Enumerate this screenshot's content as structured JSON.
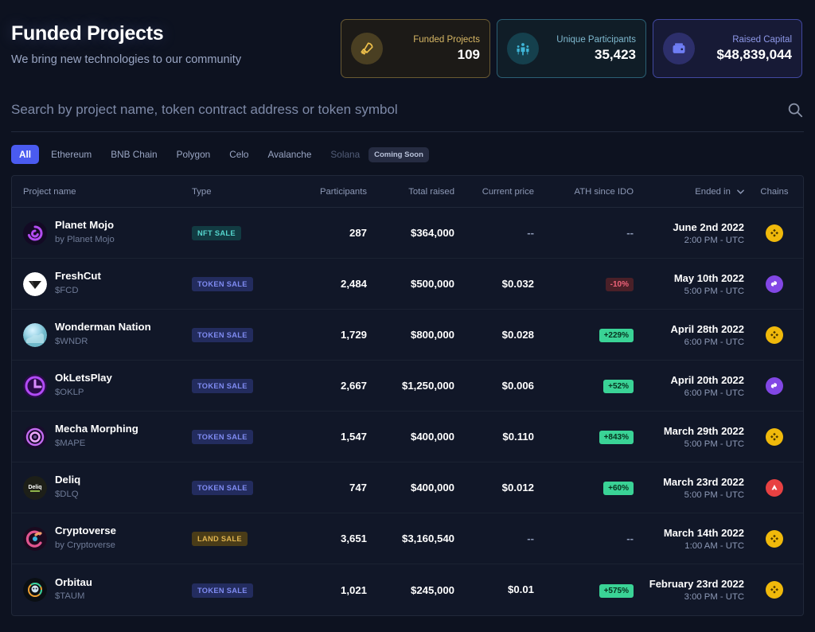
{
  "header": {
    "title": "Funded Projects",
    "subtitle": "We bring new technologies to our community",
    "stats": [
      {
        "label": "Funded Projects",
        "value": "109",
        "icon": "rocket-icon",
        "accent": "#d7b765"
      },
      {
        "label": "Unique Participants",
        "value": "35,423",
        "icon": "people-icon",
        "accent": "#7fb9cf"
      },
      {
        "label": "Raised Capital",
        "value": "$48,839,044",
        "icon": "wallet-icon",
        "accent": "#8e98e8"
      }
    ]
  },
  "search": {
    "placeholder": "Search by project name, token contract address or token symbol",
    "value": "",
    "icon": "search-icon"
  },
  "filters": {
    "tabs": [
      {
        "label": "All",
        "active": true,
        "disabled": false
      },
      {
        "label": "Ethereum",
        "active": false,
        "disabled": false
      },
      {
        "label": "BNB Chain",
        "active": false,
        "disabled": false
      },
      {
        "label": "Polygon",
        "active": false,
        "disabled": false
      },
      {
        "label": "Celo",
        "active": false,
        "disabled": false
      },
      {
        "label": "Avalanche",
        "active": false,
        "disabled": false
      },
      {
        "label": "Solana",
        "active": false,
        "disabled": true
      }
    ],
    "coming_soon_label": "Coming Soon"
  },
  "table": {
    "columns": [
      "Project name",
      "Type",
      "Participants",
      "Total raised",
      "Current price",
      "ATH since IDO",
      "Ended in",
      "Chains"
    ],
    "sort": {
      "column": "Ended in",
      "icon": "chevron-down-icon"
    },
    "rows": [
      {
        "name": "Planet Mojo",
        "sub": "by Planet Mojo",
        "logo": "planet-mojo-logo",
        "type": "NFT SALE",
        "type_kind": "nft",
        "participants": "287",
        "total_raised": "$364,000",
        "current_price": "--",
        "ath": "--",
        "ath_kind": "none",
        "date": "June 2nd 2022",
        "time": "2:00 PM - UTC",
        "chain": "BNB Chain",
        "chain_kind": "bnb"
      },
      {
        "name": "FreshCut",
        "sub": "$FCD",
        "logo": "freshcut-logo",
        "type": "TOKEN SALE",
        "type_kind": "token",
        "participants": "2,484",
        "total_raised": "$500,000",
        "current_price": "$0.032",
        "ath": "-10%",
        "ath_kind": "down",
        "date": "May 10th 2022",
        "time": "5:00 PM - UTC",
        "chain": "Polygon",
        "chain_kind": "polygon"
      },
      {
        "name": "Wonderman Nation",
        "sub": "$WNDR",
        "logo": "wonderman-nation-logo",
        "type": "TOKEN SALE",
        "type_kind": "token",
        "participants": "1,729",
        "total_raised": "$800,000",
        "current_price": "$0.028",
        "ath": "+229%",
        "ath_kind": "up",
        "date": "April 28th 2022",
        "time": "6:00 PM - UTC",
        "chain": "BNB Chain",
        "chain_kind": "bnb"
      },
      {
        "name": "OkLetsPlay",
        "sub": "$OKLP",
        "logo": "okletsplay-logo",
        "type": "TOKEN SALE",
        "type_kind": "token",
        "participants": "2,667",
        "total_raised": "$1,250,000",
        "current_price": "$0.006",
        "ath": "+52%",
        "ath_kind": "up",
        "date": "April 20th 2022",
        "time": "6:00 PM - UTC",
        "chain": "Polygon",
        "chain_kind": "polygon"
      },
      {
        "name": "Mecha Morphing",
        "sub": "$MAPE",
        "logo": "mecha-morphing-logo",
        "type": "TOKEN SALE",
        "type_kind": "token",
        "participants": "1,547",
        "total_raised": "$400,000",
        "current_price": "$0.110",
        "ath": "+843%",
        "ath_kind": "up",
        "date": "March 29th 2022",
        "time": "5:00 PM - UTC",
        "chain": "BNB Chain",
        "chain_kind": "bnb"
      },
      {
        "name": "Deliq",
        "sub": "$DLQ",
        "logo": "deliq-logo",
        "type": "TOKEN SALE",
        "type_kind": "token",
        "participants": "747",
        "total_raised": "$400,000",
        "current_price": "$0.012",
        "ath": "+60%",
        "ath_kind": "up",
        "date": "March 23rd 2022",
        "time": "5:00 PM - UTC",
        "chain": "Avalanche",
        "chain_kind": "avalanche"
      },
      {
        "name": "Cryptoverse",
        "sub": "by Cryptoverse",
        "logo": "cryptoverse-logo",
        "type": "LAND SALE",
        "type_kind": "land",
        "participants": "3,651",
        "total_raised": "$3,160,540",
        "current_price": "--",
        "ath": "--",
        "ath_kind": "none",
        "date": "March 14th 2022",
        "time": "1:00 AM - UTC",
        "chain": "BNB Chain",
        "chain_kind": "bnb"
      },
      {
        "name": "Orbitau",
        "sub": "$TAUM",
        "logo": "orbitau-logo",
        "type": "TOKEN SALE",
        "type_kind": "token",
        "participants": "1,021",
        "total_raised": "$245,000",
        "current_price": "$0.01",
        "ath": "+575%",
        "ath_kind": "up",
        "date": "February 23rd 2022",
        "time": "3:00 PM - UTC",
        "chain": "BNB Chain",
        "chain_kind": "bnb"
      }
    ]
  },
  "colors": {
    "background": "#0d1220",
    "accent": "#4a5bf0",
    "positive": "#3ad396",
    "negative": "#f0637a",
    "bnb": "#f0b90b",
    "polygon": "#8247e5",
    "avalanche": "#e84142"
  }
}
